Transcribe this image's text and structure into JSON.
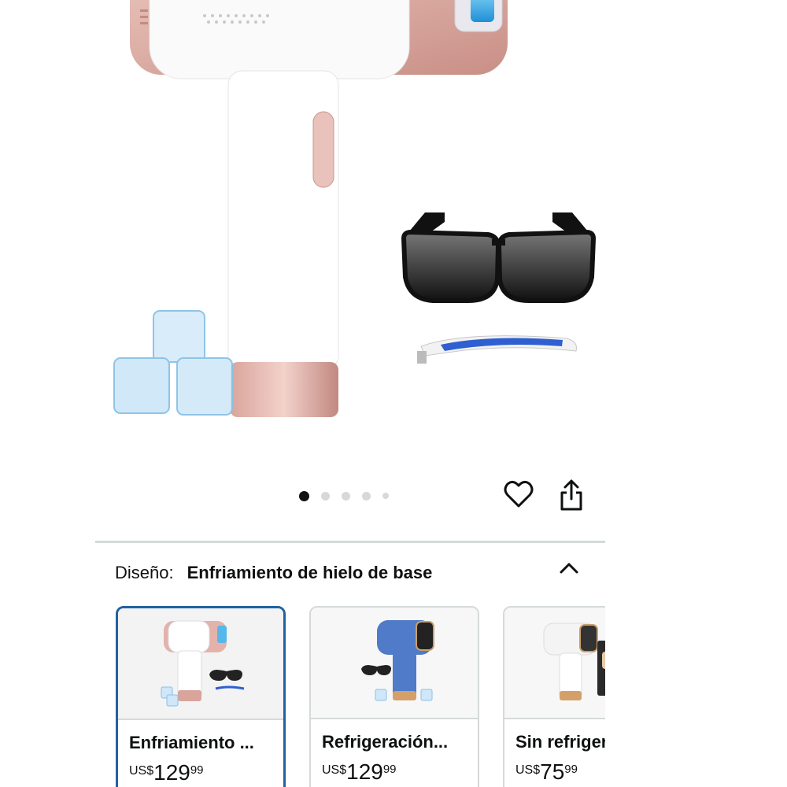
{
  "gallery": {
    "total_images": 5,
    "active_index": 0
  },
  "actions": {
    "wishlist_icon": "heart-outline-icon",
    "share_icon": "share-icon"
  },
  "variation": {
    "label": "Diseño:",
    "selected_value": "Enfriamiento de hielo de base",
    "toggle_icon": "chevron-up-icon"
  },
  "options": [
    {
      "title": "Enfriamiento ...",
      "currency": "US$",
      "price_whole": "129",
      "price_fraction": "99",
      "selected": true
    },
    {
      "title": "Refrigeración...",
      "currency": "US$",
      "price_whole": "129",
      "price_fraction": "99",
      "selected": false
    },
    {
      "title": "Sin refrigeración",
      "currency": "US$",
      "price_whole": "75",
      "price_fraction": "99",
      "selected": false
    }
  ],
  "colors": {
    "accent_selected": "#2162a1",
    "device_pink": "#d8a49c",
    "device_blue": "#4f7bc8"
  }
}
